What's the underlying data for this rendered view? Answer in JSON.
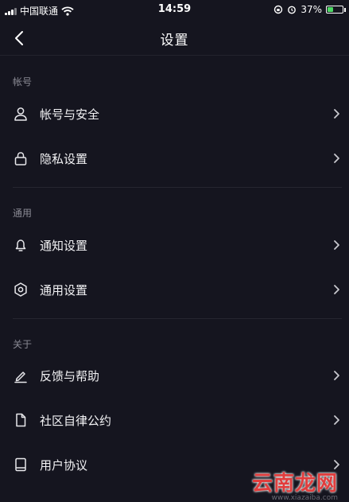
{
  "status_bar": {
    "carrier": "中国联通",
    "time": "14:59",
    "battery": "37%",
    "battery_level": 0.37,
    "battery_color": "#4cd964"
  },
  "nav": {
    "title": "设置",
    "back_icon": "chevron-left-icon"
  },
  "sections": {
    "account": {
      "header": "帐号",
      "items": [
        {
          "label": "帐号与安全",
          "icon": "user-icon"
        },
        {
          "label": "隐私设置",
          "icon": "lock-icon"
        }
      ]
    },
    "general": {
      "header": "通用",
      "items": [
        {
          "label": "通知设置",
          "icon": "bell-icon"
        },
        {
          "label": "通用设置",
          "icon": "gear-icon"
        }
      ]
    },
    "about": {
      "header": "关于",
      "items": [
        {
          "label": "反馈与帮助",
          "icon": "pencil-icon"
        },
        {
          "label": "社区自律公约",
          "icon": "document-icon"
        },
        {
          "label": "用户协议",
          "icon": "book-icon"
        }
      ]
    }
  },
  "watermark": {
    "text": "云南龙网",
    "sub": "www.xiazaiba.com"
  },
  "colors": {
    "background": "#15151f",
    "section_header": "#8a8a94",
    "watermark_red": "#e13d3d"
  }
}
